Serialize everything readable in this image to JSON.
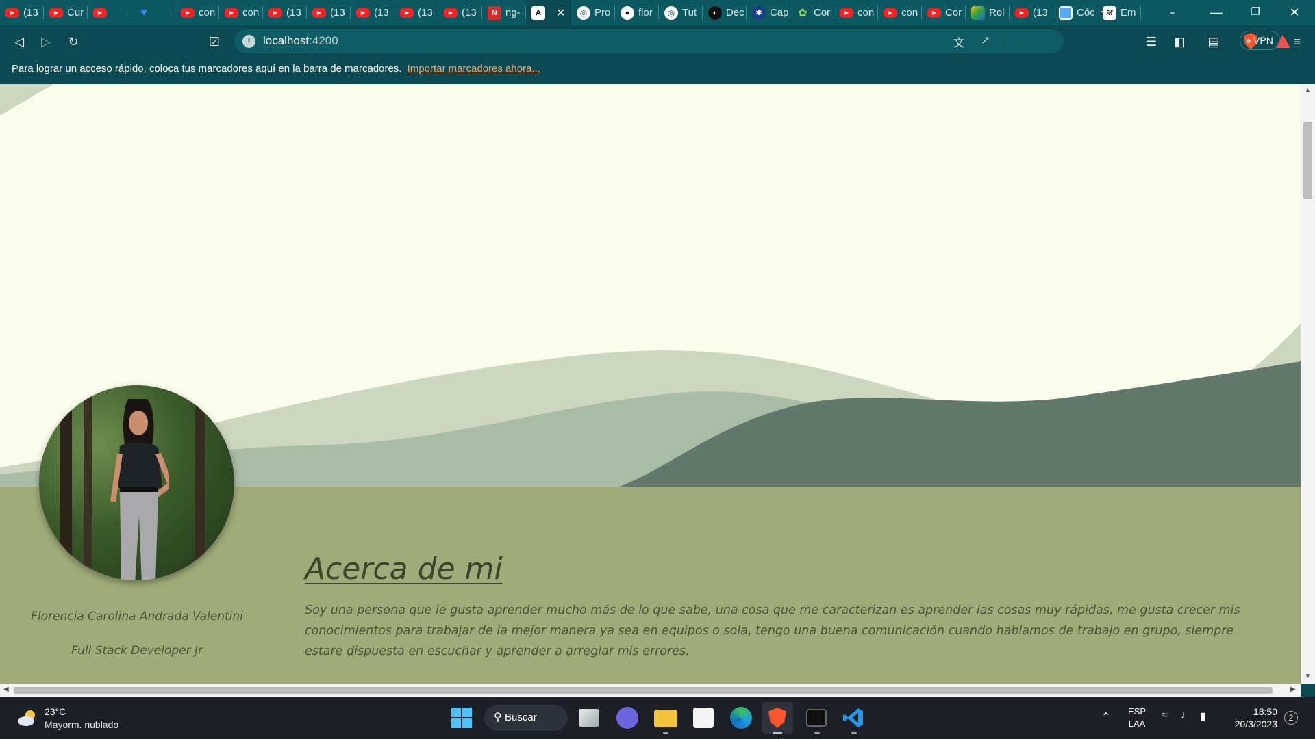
{
  "browser": {
    "tabs": [
      {
        "label": "(13",
        "icon": "youtube-icon",
        "kind": "yt"
      },
      {
        "label": "Cur",
        "icon": "youtube-icon",
        "kind": "yt"
      },
      {
        "label": "",
        "icon": "youtube-icon",
        "kind": "yt"
      },
      {
        "label": "",
        "icon": "heart-icon",
        "kind": "heart"
      },
      {
        "label": "con",
        "icon": "youtube-icon",
        "kind": "yt"
      },
      {
        "label": "con",
        "icon": "youtube-icon",
        "kind": "yt"
      },
      {
        "label": "(13",
        "icon": "youtube-icon",
        "kind": "yt"
      },
      {
        "label": "(13",
        "icon": "youtube-icon",
        "kind": "yt"
      },
      {
        "label": "(13",
        "icon": "youtube-icon",
        "kind": "yt"
      },
      {
        "label": "(13",
        "icon": "youtube-icon",
        "kind": "yt"
      },
      {
        "label": "(13",
        "icon": "youtube-icon",
        "kind": "yt"
      },
      {
        "label": "ng-",
        "icon": "ng-icon",
        "kind": "ng"
      },
      {
        "label": "",
        "icon": "angular-icon",
        "kind": "ang",
        "active": true
      },
      {
        "label": "Pro",
        "icon": "globe-icon",
        "kind": "globe"
      },
      {
        "label": "flor",
        "icon": "github-icon",
        "kind": "gh"
      },
      {
        "label": "Tut",
        "icon": "globe-icon",
        "kind": "globe"
      },
      {
        "label": "Dec",
        "icon": "dark-circle-icon",
        "kind": "dark"
      },
      {
        "label": "Cap",
        "icon": "blue-circle-icon",
        "kind": "blue"
      },
      {
        "label": "Cor",
        "icon": "leaf-icon",
        "kind": "green"
      },
      {
        "label": "con",
        "icon": "youtube-icon",
        "kind": "yt"
      },
      {
        "label": "con",
        "icon": "youtube-icon",
        "kind": "yt"
      },
      {
        "label": "Cor",
        "icon": "youtube-icon",
        "kind": "yt"
      },
      {
        "label": "Rol",
        "icon": "multicolor-icon",
        "kind": "multi"
      },
      {
        "label": "(13",
        "icon": "youtube-icon",
        "kind": "yt"
      },
      {
        "label": "Cóc",
        "icon": "square-icon",
        "kind": "sq"
      },
      {
        "label": "Em",
        "icon": "m-icon",
        "kind": "mm"
      }
    ],
    "address": {
      "host": "localhost",
      "port": ":4200"
    },
    "vpn_label": "VPN",
    "bookmarks_prompt": "Para lograr un acceso rápido, coloca tus marcadores aquí en la barra de marcadores.",
    "bookmarks_link": "Importar marcadores ahora..."
  },
  "page": {
    "name": "Florencia Carolina Andrada Valentini",
    "role": "Full Stack Developer Jr",
    "about_title": "Acerca de mi",
    "about_text": "Soy una persona que le gusta aprender mucho más de lo que sabe, una cosa que me caracterizan es aprender las cosas muy rápidas, me gusta crecer mis conocimientos para trabajar de la mejor manera ya sea en equipos o sola, tengo una buena comunicación cuando hablamos de trabajo en grupo, siempre estare dispuesta en escuchar y aprender a arreglar mis errores.",
    "colors": {
      "hero_bg": "#fbfdec",
      "about_bg": "#9fab78",
      "wave_light": "#cdd7bf",
      "wave_mid": "#a9bca6",
      "wave_dark": "#61786a"
    }
  },
  "taskbar": {
    "weather_temp": "23°C",
    "weather_desc": "Mayorm. nublado",
    "search_label": "Buscar",
    "lang_top": "ESP",
    "lang_bottom": "LAA",
    "time": "18:50",
    "date": "20/3/2023",
    "notifications": "2"
  }
}
